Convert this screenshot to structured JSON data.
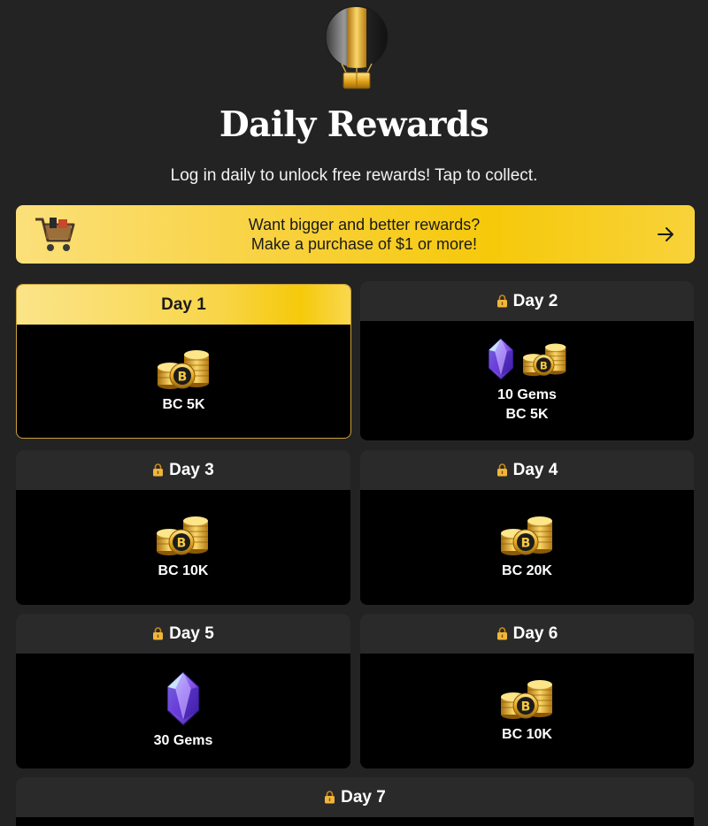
{
  "page": {
    "title": "Daily Rewards",
    "subtitle": "Log in daily to unlock free rewards! Tap to collect."
  },
  "promo": {
    "line1": "Want bigger and better rewards?",
    "line2": "Make a purchase of $1 or more!",
    "cart_icon": "shopping-cart-icon",
    "arrow_icon": "arrow-right-icon"
  },
  "colors": {
    "background": "#232323",
    "accent_gold": "#f6c90a",
    "card_body": "#000000",
    "card_header": "#2a2a2a"
  },
  "days": [
    {
      "label": "Day 1",
      "locked": false,
      "active": true,
      "rewards": [
        "BC 5K"
      ],
      "icons": [
        "coins-icon"
      ]
    },
    {
      "label": "Day 2",
      "locked": true,
      "active": false,
      "rewards": [
        "10 Gems",
        "BC 5K"
      ],
      "icons": [
        "gem-icon",
        "coins-icon"
      ]
    },
    {
      "label": "Day 3",
      "locked": true,
      "active": false,
      "rewards": [
        "BC 10K"
      ],
      "icons": [
        "coins-icon"
      ]
    },
    {
      "label": "Day 4",
      "locked": true,
      "active": false,
      "rewards": [
        "BC 20K"
      ],
      "icons": [
        "coins-icon"
      ]
    },
    {
      "label": "Day 5",
      "locked": true,
      "active": false,
      "rewards": [
        "30 Gems"
      ],
      "icons": [
        "gem-icon"
      ]
    },
    {
      "label": "Day 6",
      "locked": true,
      "active": false,
      "rewards": [
        "BC 10K"
      ],
      "icons": [
        "coins-icon"
      ]
    },
    {
      "label": "Day 7",
      "locked": true,
      "active": false,
      "rewards": [],
      "icons": []
    }
  ]
}
